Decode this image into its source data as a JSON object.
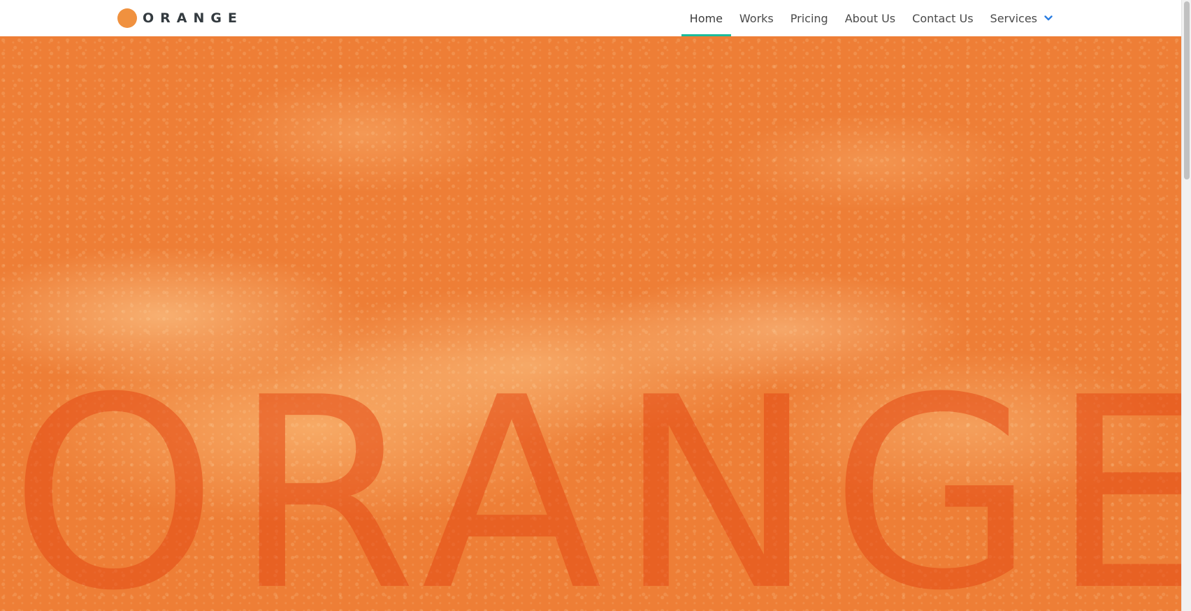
{
  "brand": {
    "name": "ORANGE",
    "dot_color": "#f0913f"
  },
  "nav": {
    "items": [
      {
        "label": "Home",
        "active": true
      },
      {
        "label": "Works",
        "active": false
      },
      {
        "label": "Pricing",
        "active": false
      },
      {
        "label": "About Us",
        "active": false
      },
      {
        "label": "Contact Us",
        "active": false
      },
      {
        "label": "Services",
        "active": false,
        "icon": "chevron-down-icon"
      }
    ],
    "active_underline_color": "#1abc9c",
    "chevron_color": "#2a7de1"
  },
  "hero": {
    "title": "ORANGE",
    "background_color": "#ee7e36"
  }
}
